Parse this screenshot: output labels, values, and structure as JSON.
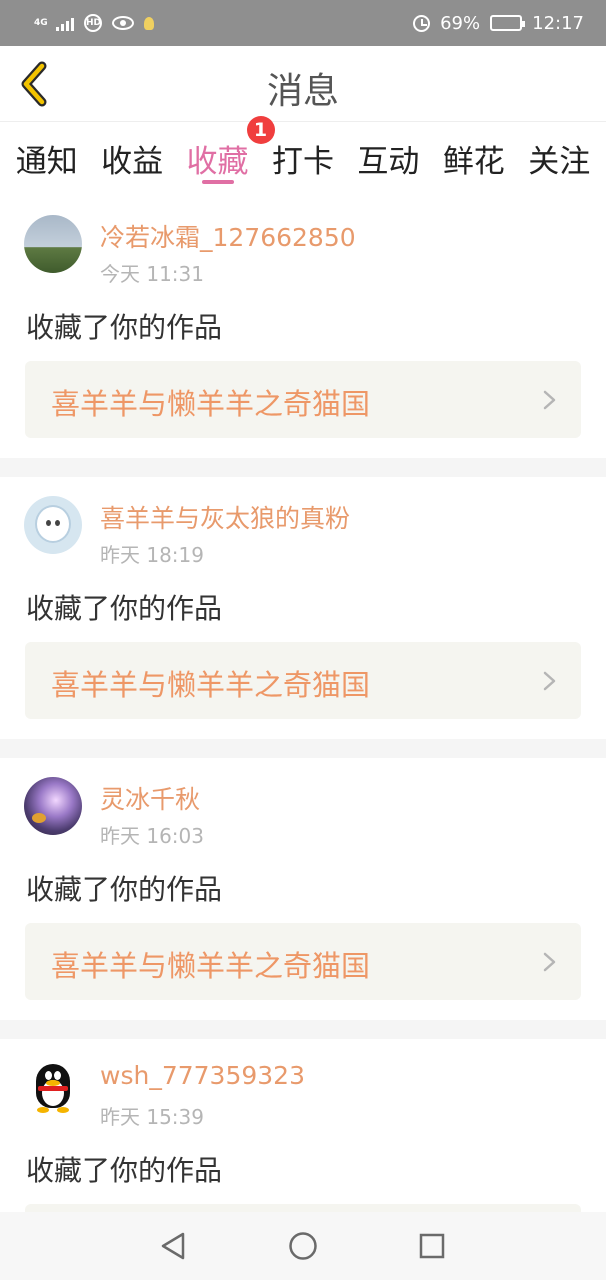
{
  "status_bar": {
    "network_label": "4G",
    "hd_label": "HD",
    "battery_percent": "69%",
    "battery_level": 0.69,
    "time": "12:17",
    "icons": [
      "signal-icon",
      "hd-icon",
      "eye-icon",
      "bulb-icon",
      "alarm-icon",
      "battery-icon"
    ]
  },
  "header": {
    "title": "消息",
    "back_icon": "chevron-left-icon"
  },
  "tabs": [
    {
      "label": "通知",
      "active": false
    },
    {
      "label": "收益",
      "active": false
    },
    {
      "label": "收藏",
      "active": true,
      "badge": "1"
    },
    {
      "label": "打卡",
      "active": false
    },
    {
      "label": "互动",
      "active": false
    },
    {
      "label": "鲜花",
      "active": false
    },
    {
      "label": "关注",
      "active": false
    }
  ],
  "notifications": [
    {
      "username": "冷若冰霜_127662850",
      "time": "今天 11:31",
      "action": "收藏了你的作品",
      "work_title": "喜羊羊与懒羊羊之奇猫国",
      "avatar": "landscape-avatar"
    },
    {
      "username": "喜羊羊与灰太狼的真粉",
      "time": "昨天 18:19",
      "action": "收藏了你的作品",
      "work_title": "喜羊羊与懒羊羊之奇猫国",
      "avatar": "sheep-avatar"
    },
    {
      "username": "灵冰千秋",
      "time": "昨天 16:03",
      "action": "收藏了你的作品",
      "work_title": "喜羊羊与懒羊羊之奇猫国",
      "avatar": "anime-avatar"
    },
    {
      "username": "wsh_777359323",
      "time": "昨天 15:39",
      "action": "收藏了你的作品",
      "work_title": "",
      "avatar": "qq-penguin-avatar"
    }
  ],
  "nav_bar": {
    "icons": [
      "back-triangle-icon",
      "home-circle-icon",
      "recents-square-icon"
    ]
  },
  "colors": {
    "accent_pink": "#e06fa4",
    "username_orange": "#e89a6c",
    "work_title_orange": "#ee9766",
    "badge_red": "#f03e3e",
    "status_bar_gray": "#8f8f8f"
  }
}
